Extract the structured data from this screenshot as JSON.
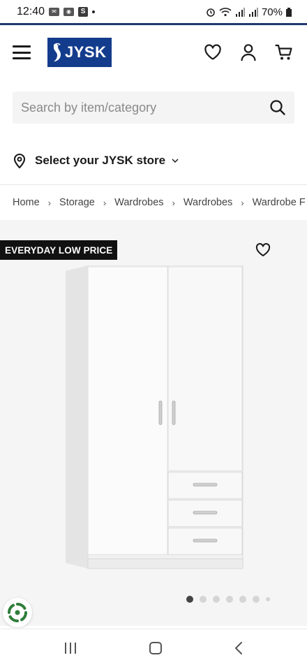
{
  "status_bar": {
    "time": "12:40",
    "notif_icons": [
      "outlook-icon",
      "ring-icon",
      "s-icon"
    ],
    "battery": "70%"
  },
  "header": {
    "logo_text": "JYSK",
    "icons": [
      "wishlist-heart-icon",
      "account-icon",
      "cart-icon"
    ]
  },
  "search": {
    "placeholder": "Search by item/category"
  },
  "store": {
    "label": "Select your JYSK store"
  },
  "breadcrumb": [
    "Home",
    "Storage",
    "Wardrobes",
    "Wardrobes",
    "Wardrobe F"
  ],
  "product": {
    "badge": "EVERYDAY LOW PRICE",
    "image_count": 7,
    "active_image": 1
  },
  "colors": {
    "brand": "#143c8c",
    "accent_line": "#1f3a6e",
    "badge_bg": "#111111"
  }
}
